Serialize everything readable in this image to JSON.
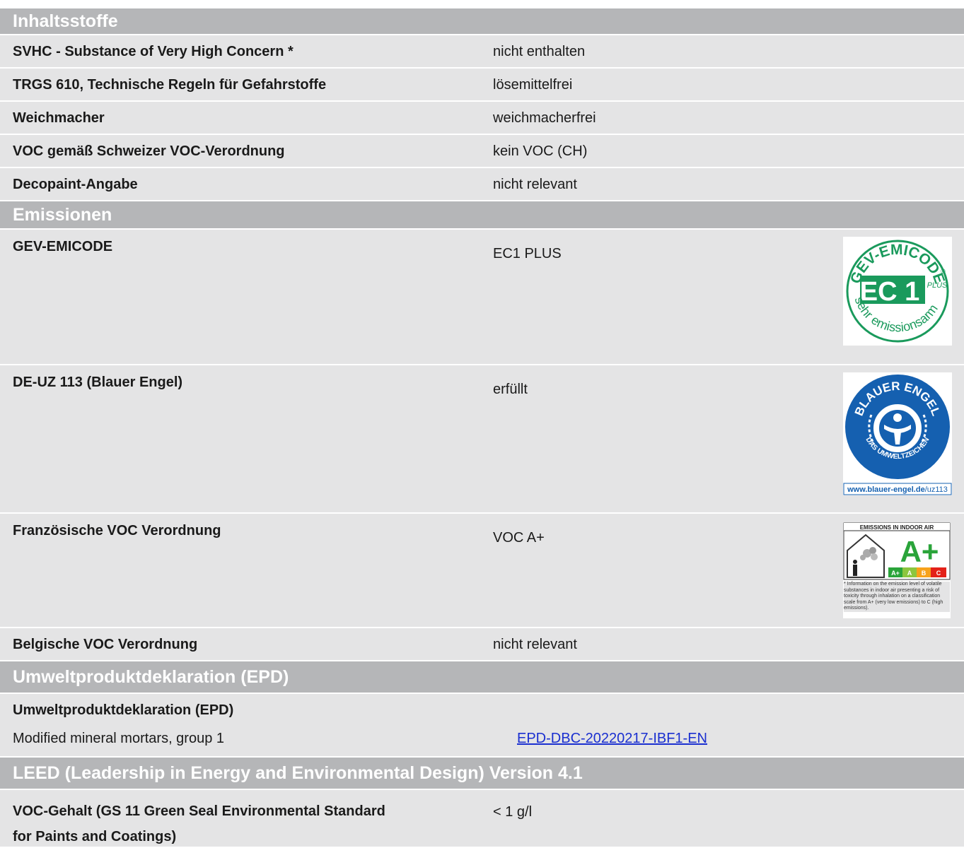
{
  "sections": {
    "ingredients": {
      "title": "Inhaltsstoffe",
      "rows": [
        {
          "label": "SVHC - Substance of Very High Concern *",
          "value": "nicht enthalten"
        },
        {
          "label": "TRGS 610, Technische Regeln für Gefahrstoffe",
          "value": "lösemittelfrei"
        },
        {
          "label": "Weichmacher",
          "value": "weichmacherfrei"
        },
        {
          "label": "VOC gemäß Schweizer VOC-Verordnung",
          "value": "kein VOC (CH)"
        },
        {
          "label": "Decopaint-Angabe",
          "value": "nicht relevant"
        }
      ]
    },
    "emissions": {
      "title": "Emissionen",
      "rows": [
        {
          "label": "GEV-EMICODE",
          "value": "EC1 PLUS",
          "badge": {
            "arc_top": "GEV-EMICODE",
            "big": "EC 1",
            "plus": "PLUS",
            "arc_bottom": "sehr emissionsarm",
            "reg": "®",
            "color": "#1a9a5c"
          }
        },
        {
          "label": "DE-UZ 113 (Blauer Engel)",
          "value": "erfüllt",
          "badge": {
            "arc_top": "BLAUER ENGEL",
            "arc_bottom": "DAS UMWELTZEICHEN",
            "url_bold": "www.blauer-engel.de",
            "url_rest": "/uz113",
            "color": "#1560b0"
          }
        },
        {
          "label": "Französische VOC Verordnung",
          "value": "VOC A+",
          "badge": {
            "header": "EMISSIONS IN INDOOR AIR",
            "big": "A+",
            "scale": [
              "A+",
              "A",
              "B",
              "C"
            ],
            "footnote": "* Information on the emission level of volatile substances in indoor air presenting a risk of toxicity through inhalation on a classification scale from A+ (very low emissions) to C (high emissions)."
          }
        },
        {
          "label": "Belgische VOC Verordnung",
          "value": "nicht relevant"
        }
      ]
    },
    "epd": {
      "title": "Umweltproduktdeklaration (EPD)",
      "subheading": "Umweltproduktdeklaration (EPD)",
      "row": {
        "label": "Modified mineral mortars, group 1",
        "link": "EPD-DBC-20220217-IBF1-EN"
      }
    },
    "leed": {
      "title": "LEED (Leadership in Energy and Environmental Design) Version 4.1",
      "row": {
        "label_line1": "VOC-Gehalt (GS 11 Green Seal Environmental Standard",
        "label_line2": "for Paints and Coatings)",
        "value": "< 1 g/l"
      }
    }
  }
}
